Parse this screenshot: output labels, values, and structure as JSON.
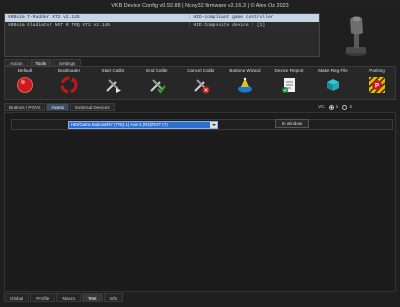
{
  "window": {
    "title": "VKB Device Config v0.92.88 | Ncoy32 firmware v2.16.3 | © Alex Oz 2023"
  },
  "devices": [
    {
      "name": "VKBsim T-Rudder XT2 v2.145",
      "desc": ": HID-compliant game controller"
    },
    {
      "name": "VKBsim Gladiator NXT R TRQ XT2 v2.145",
      "desc": ": HID Composite device : [2]"
    }
  ],
  "main_tabs": [
    "Action",
    "Tools",
    "Settings"
  ],
  "toolbar": {
    "default": "Default",
    "bootloader": "Bootloader",
    "start_calibr": "Start Calibr",
    "end_calibr": "End Calibr",
    "cancel_calibr": "Cancel Calibr",
    "buttons_wizard": "Buttons Wizard",
    "device_report": "Device Report",
    "make_reg_file": "Make Reg File",
    "parking": "Parking"
  },
  "sub_tabs": [
    "Buttons / POVs",
    "Axes1",
    "External Devices"
  ],
  "vc": {
    "label": "VC",
    "options": [
      "1",
      "2"
    ],
    "selected": "1"
  },
  "axis_select": {
    "value": "HID/Game Buttons/RY (TRQ 1) Axis 5 (RZ)/ROT (Y)",
    "window_button": "In window"
  },
  "bottom_tabs": [
    "Global",
    "Profile",
    "Macro",
    "Test",
    "Info"
  ],
  "colors": {
    "accent": "#2f6fd0",
    "selected_row": "#c4d4e4",
    "danger": "#cc1a1a",
    "check": "#2aa52a"
  }
}
